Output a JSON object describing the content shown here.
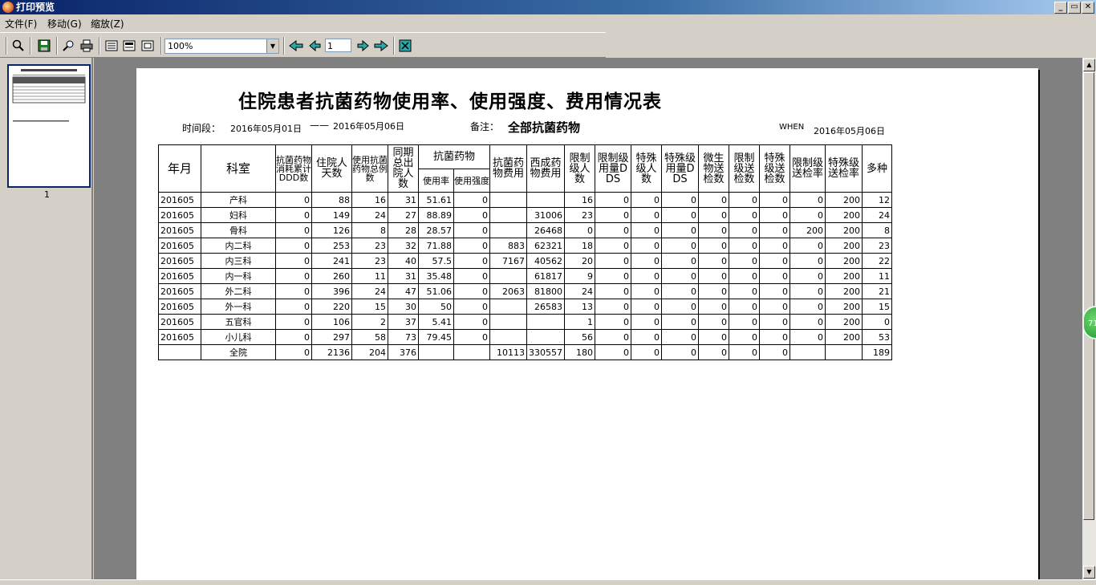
{
  "window": {
    "title": "打印预览",
    "min_label": "_",
    "restore_label": "▭",
    "close_label": "✕"
  },
  "menu": [
    {
      "label": "文件(F)"
    },
    {
      "label": "移动(G)"
    },
    {
      "label": "缩放(Z)"
    }
  ],
  "toolbar": {
    "zoom_value": "100%",
    "page_value": "1"
  },
  "thumbnail": {
    "page_number": "1"
  },
  "report": {
    "title": "住院患者抗菌药物使用率、使用强度、费用情况表",
    "period_label": "时间段：",
    "period_start": "2016年05月01日",
    "period_sep": "——",
    "period_end": "2016年05月06日",
    "remark_label": "备注：",
    "remark_value": "全部抗菌药物",
    "when_label": "WHEN",
    "when_value": "2016年05月06日"
  },
  "table": {
    "headers": {
      "h1": "年月",
      "h2": "科室",
      "h3": "抗菌药物消耗累计DDD数",
      "h4": "住院人天数",
      "h5": "使用抗菌药物总例数",
      "h6": "同期总出院人数",
      "group": "抗菌药物",
      "h7a": "使用率",
      "h7b": "使用强度",
      "h8": "抗菌药物费用",
      "h9": "西成药物费用",
      "h10": "限制级人数",
      "h11": "限制级用量DDS",
      "h12": "特殊级人数",
      "h13": "特殊级用量DDS",
      "h14": "微生物送检数",
      "h15": "限制级送检数",
      "h16": "特殊级送检数",
      "h17": "限制级送检率",
      "h18": "特殊级送检率",
      "h19": "多种"
    },
    "rows": [
      [
        "201605",
        "产科",
        "0",
        "88",
        "16",
        "31",
        "51.61",
        "0",
        "",
        "",
        "16",
        "0",
        "0",
        "0",
        "0",
        "0",
        "0",
        "0",
        "200",
        "12"
      ],
      [
        "201605",
        "妇科",
        "0",
        "149",
        "24",
        "27",
        "88.89",
        "0",
        "",
        "31006",
        "23",
        "0",
        "0",
        "0",
        "0",
        "0",
        "0",
        "0",
        "200",
        "24"
      ],
      [
        "201605",
        "骨科",
        "0",
        "126",
        "8",
        "28",
        "28.57",
        "0",
        "",
        "26468",
        "0",
        "0",
        "0",
        "0",
        "0",
        "0",
        "0",
        "200",
        "200",
        "8"
      ],
      [
        "201605",
        "内二科",
        "0",
        "253",
        "23",
        "32",
        "71.88",
        "0",
        "883",
        "62321",
        "18",
        "0",
        "0",
        "0",
        "0",
        "0",
        "0",
        "0",
        "200",
        "23"
      ],
      [
        "201605",
        "内三科",
        "0",
        "241",
        "23",
        "40",
        "57.5",
        "0",
        "7167",
        "40562",
        "20",
        "0",
        "0",
        "0",
        "0",
        "0",
        "0",
        "0",
        "200",
        "22"
      ],
      [
        "201605",
        "内一科",
        "0",
        "260",
        "11",
        "31",
        "35.48",
        "0",
        "",
        "61817",
        "9",
        "0",
        "0",
        "0",
        "0",
        "0",
        "0",
        "0",
        "200",
        "11"
      ],
      [
        "201605",
        "外二科",
        "0",
        "396",
        "24",
        "47",
        "51.06",
        "0",
        "2063",
        "81800",
        "24",
        "0",
        "0",
        "0",
        "0",
        "0",
        "0",
        "0",
        "200",
        "21"
      ],
      [
        "201605",
        "外一科",
        "0",
        "220",
        "15",
        "30",
        "50",
        "0",
        "",
        "26583",
        "13",
        "0",
        "0",
        "0",
        "0",
        "0",
        "0",
        "0",
        "200",
        "15"
      ],
      [
        "201605",
        "五官科",
        "0",
        "106",
        "2",
        "37",
        "5.41",
        "0",
        "",
        "",
        "1",
        "0",
        "0",
        "0",
        "0",
        "0",
        "0",
        "0",
        "200",
        "0"
      ],
      [
        "201605",
        "小儿科",
        "0",
        "297",
        "58",
        "73",
        "79.45",
        "0",
        "",
        "",
        "56",
        "0",
        "0",
        "0",
        "0",
        "0",
        "0",
        "0",
        "200",
        "53"
      ]
    ],
    "total": [
      "",
      "全院",
      "0",
      "2136",
      "204",
      "376",
      "",
      "",
      "10113",
      "330557",
      "180",
      "0",
      "0",
      "0",
      "0",
      "0",
      "0",
      "",
      "",
      "189"
    ]
  },
  "badge": {
    "text": "71"
  }
}
